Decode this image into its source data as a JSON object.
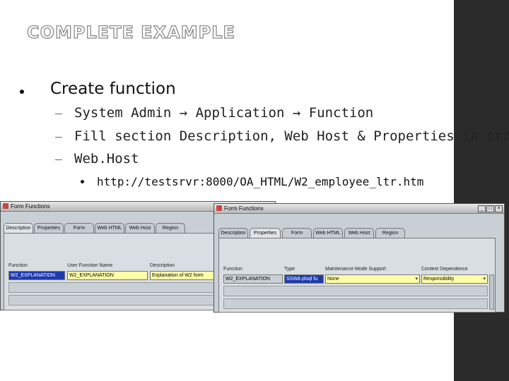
{
  "slide": {
    "title": "COMPLETE EXAMPLE",
    "bullet": "Create function",
    "sub_bullets": [
      "System Admin → Application → Function",
      "Fill section Description, Web Host & Properties in order",
      "Web.Host"
    ],
    "url": "http://testsrvr:8000/OA_HTML/W2_employee_ltr.htm"
  },
  "left_window": {
    "title": "Form Functions",
    "tabs": [
      "Description",
      "Properties",
      "Form",
      "Web HTML",
      "Web Host",
      "Region"
    ],
    "columns": [
      "Function",
      "User Function Name",
      "Description"
    ],
    "row": {
      "function": "W2_EXPLANATION",
      "user_function_name": "W2_EXPLANATION",
      "description": "Explanation of W2 form"
    }
  },
  "right_window": {
    "title": "Form Functions",
    "tabs": [
      "Description",
      "Properties",
      "Form",
      "Web HTML",
      "Web Host",
      "Region"
    ],
    "columns": [
      "Function",
      "Type",
      "Maintenance Mode Support",
      "Context Dependence"
    ],
    "row": {
      "function": "W2_EXPLANATION",
      "type": "SSWA plsql fu",
      "maintenance_mode_support": "None",
      "context_dependence": "Responsibility"
    }
  }
}
